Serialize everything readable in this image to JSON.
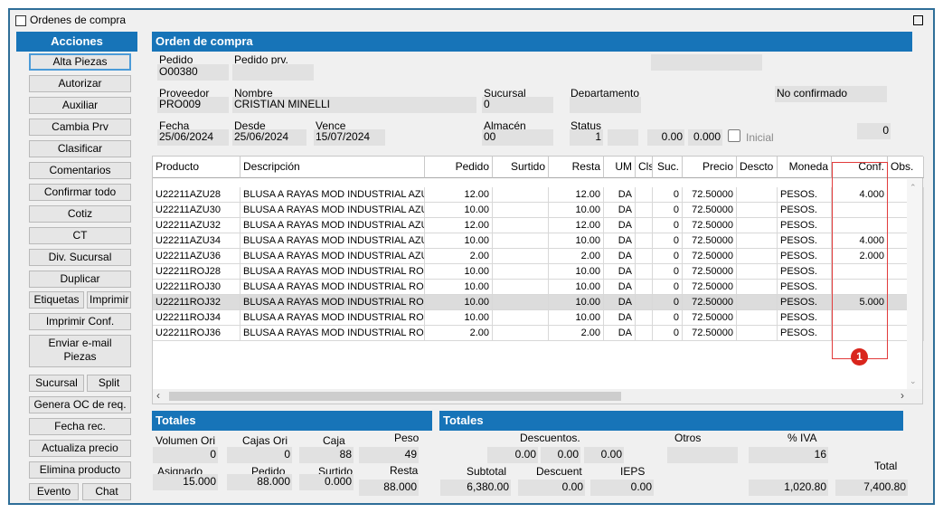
{
  "window": {
    "title": "Ordenes de compra"
  },
  "sidebar": {
    "header": "Acciones",
    "buttons": [
      "Alta Piezas",
      "Autorizar",
      "Auxiliar",
      "Cambia Prv",
      "Clasificar",
      "Comentarios",
      "Confirmar todo",
      "Cotiz",
      "CT",
      "Div. Sucursal",
      "Duplicar"
    ],
    "etiquetas": "Etiquetas",
    "imprimir": "Imprimir",
    "imprimir_conf": "Imprimir Conf.",
    "enviar_email": "Enviar e-mail",
    "piezas": "Piezas",
    "sucursal": "Sucursal",
    "split": "Split",
    "buttons2": [
      "Genera OC de req.",
      "Fecha rec.",
      "Actualiza precio",
      "Elimina producto"
    ],
    "evento": "Evento",
    "chat": "Chat"
  },
  "order": {
    "header": "Orden de compra",
    "pedido_label": "Pedido",
    "pedido_value": "O00380",
    "pedido_prv_label": "Pedido prv.",
    "pedido_prv_value": "",
    "proveedor_label": "Proveedor",
    "proveedor_value": "PRO009",
    "nombre_label": "Nombre",
    "nombre_value": "CRISTIAN MINELLI",
    "sucursal_label": "Sucursal",
    "sucursal_value": "0",
    "departamento_label": "Departamento",
    "departamento_value": "",
    "status_text": "No confirmado",
    "fecha_label": "Fecha",
    "fecha_value": "25/06/2024",
    "desde_label": "Desde",
    "desde_value": "25/06/2024",
    "vence_label": "Vence",
    "vence_value": "15/07/2024",
    "almacen_label": "Almacén",
    "almacen_value": "00",
    "status_label": "Status",
    "status_value": "1",
    "val_a": "0.00",
    "val_b": "0.000",
    "inicial_label": "Inicial",
    "right_value": "0"
  },
  "grid": {
    "columns": [
      "Producto",
      "Descripción",
      "Pedido",
      "Surtido",
      "Resta",
      "UM",
      "Cls",
      "Suc.",
      "Precio",
      "Descto",
      "Moneda",
      "Conf.",
      "Obs."
    ],
    "rows": [
      [
        "U22211AZU28",
        "BLUSA A RAYAS MOD INDUSTRIAL AZU",
        "12.00",
        "",
        "12.00",
        "DA",
        "",
        "0",
        "72.50000",
        "",
        "PESOS.",
        "4.000",
        ""
      ],
      [
        "U22211AZU30",
        "BLUSA A RAYAS MOD INDUSTRIAL AZU",
        "10.00",
        "",
        "10.00",
        "DA",
        "",
        "0",
        "72.50000",
        "",
        "PESOS.",
        "",
        ""
      ],
      [
        "U22211AZU32",
        "BLUSA A RAYAS MOD INDUSTRIAL AZU",
        "12.00",
        "",
        "12.00",
        "DA",
        "",
        "0",
        "72.50000",
        "",
        "PESOS.",
        "",
        ""
      ],
      [
        "U22211AZU34",
        "BLUSA A RAYAS MOD INDUSTRIAL AZU",
        "10.00",
        "",
        "10.00",
        "DA",
        "",
        "0",
        "72.50000",
        "",
        "PESOS.",
        "4.000",
        ""
      ],
      [
        "U22211AZU36",
        "BLUSA A RAYAS MOD INDUSTRIAL AZU",
        "2.00",
        "",
        "2.00",
        "DA",
        "",
        "0",
        "72.50000",
        "",
        "PESOS.",
        "2.000",
        ""
      ],
      [
        "U22211ROJ28",
        "BLUSA A RAYAS MOD INDUSTRIAL ROJ",
        "10.00",
        "",
        "10.00",
        "DA",
        "",
        "0",
        "72.50000",
        "",
        "PESOS.",
        "",
        ""
      ],
      [
        "U22211ROJ30",
        "BLUSA A RAYAS MOD INDUSTRIAL ROJ",
        "10.00",
        "",
        "10.00",
        "DA",
        "",
        "0",
        "72.50000",
        "",
        "PESOS.",
        "",
        ""
      ],
      [
        "U22211ROJ32",
        "BLUSA A RAYAS MOD INDUSTRIAL ROJ",
        "10.00",
        "",
        "10.00",
        "DA",
        "",
        "0",
        "72.50000",
        "",
        "PESOS.",
        "5.000",
        ""
      ],
      [
        "U22211ROJ34",
        "BLUSA A RAYAS MOD INDUSTRIAL ROJ",
        "10.00",
        "",
        "10.00",
        "DA",
        "",
        "0",
        "72.50000",
        "",
        "PESOS.",
        "",
        ""
      ],
      [
        "U22211ROJ36",
        "BLUSA A RAYAS MOD INDUSTRIAL ROJ",
        "2.00",
        "",
        "2.00",
        "DA",
        "",
        "0",
        "72.50000",
        "",
        "PESOS.",
        "",
        ""
      ]
    ],
    "selected_row": 7
  },
  "annotation": {
    "badge": "1"
  },
  "totales_left": {
    "header": "Totales",
    "volumen_ori_label": "Volumen Ori",
    "volumen_ori_value": "0",
    "cajas_ori_label": "Cajas Ori",
    "cajas_ori_value": "0",
    "caja_label": "Caja",
    "caja_value": "88",
    "peso_label": "Peso",
    "peso_value": "49",
    "asignado_label": "Asignado",
    "asignado_value": "15.000",
    "pedido_label": "Pedido",
    "pedido_value": "88.000",
    "surtido_label": "Surtido",
    "surtido_value": "0.000",
    "resta_label": "Resta",
    "resta_value": "88.000"
  },
  "totales_right": {
    "header": "Totales",
    "descuentos_label": "Descuentos.",
    "desc1": "0.00",
    "desc2": "0.00",
    "desc3": "0.00",
    "otros_label": "Otros",
    "otros_value": "",
    "iva_label": "% IVA",
    "iva_value": "16",
    "total_label": "Total",
    "subtotal_label": "Subtotal",
    "subtotal_value": "6,380.00",
    "descuent_label": "Descuent",
    "descuent_value": "0.00",
    "ieps_label": "IEPS",
    "ieps_value": "0.00",
    "iva_amount": "1,020.80",
    "total_value": "7,400.80"
  }
}
